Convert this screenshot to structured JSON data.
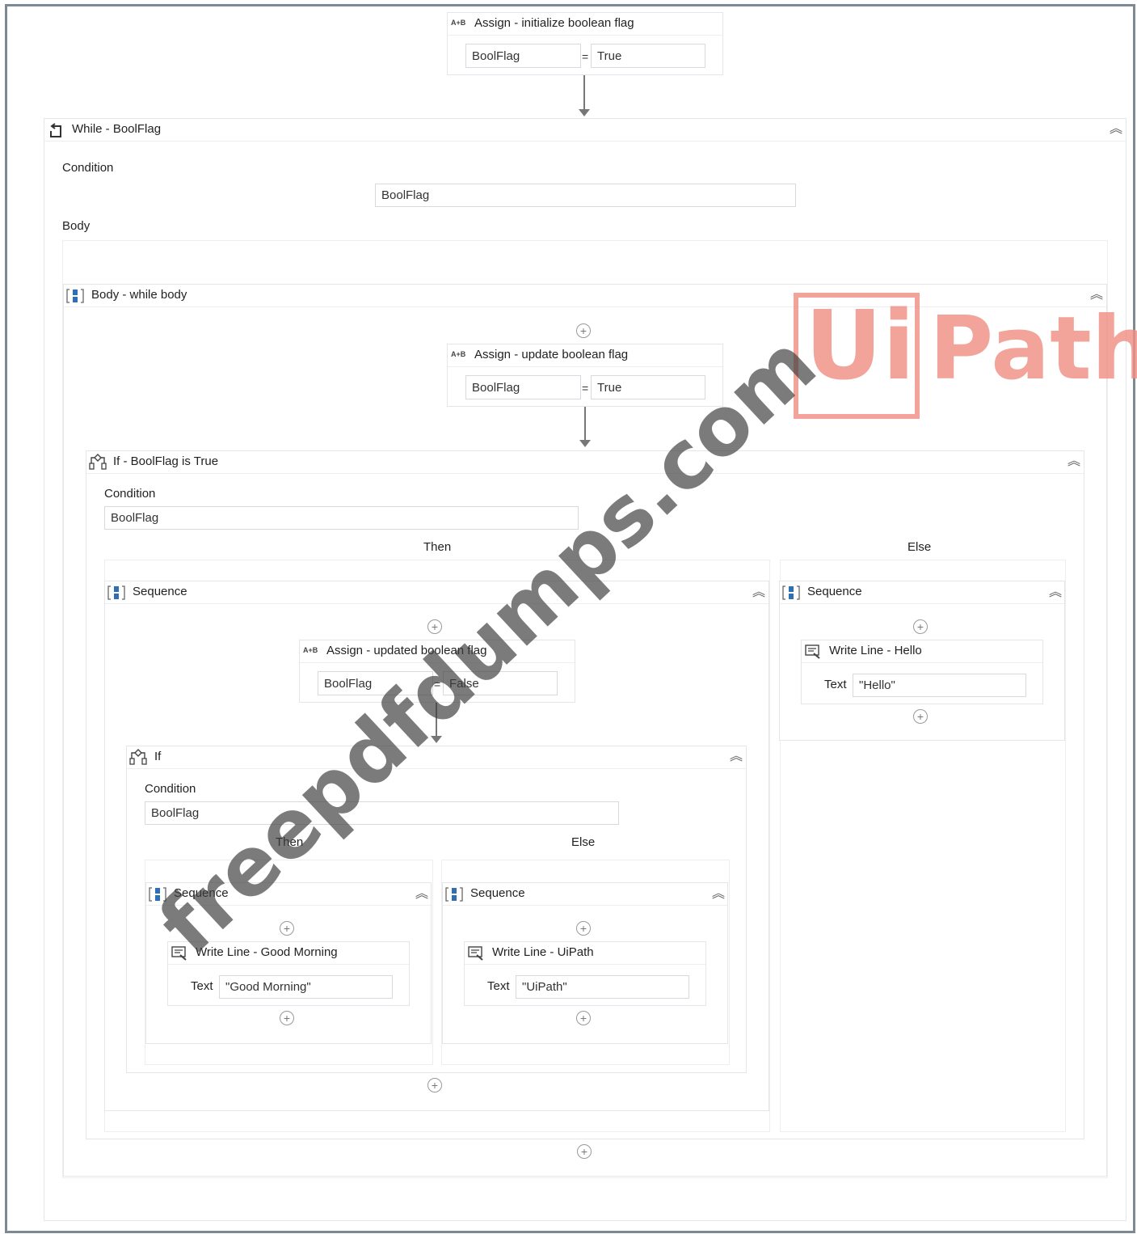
{
  "assign_init": {
    "title": "Assign - initialize boolean flag",
    "icon": "assign-icon",
    "left": "BoolFlag",
    "op": "=",
    "right": "True"
  },
  "while_block": {
    "title": "While - BoolFlag",
    "icon": "while-loop-icon",
    "condition_label": "Condition",
    "condition_value": "BoolFlag",
    "body_label": "Body"
  },
  "body_seq": {
    "title": "Body - while body",
    "icon": "sequence-icon"
  },
  "assign_update": {
    "title": "Assign - update boolean flag",
    "left": "BoolFlag",
    "op": "=",
    "right": "True"
  },
  "if_outer": {
    "title": "If - BoolFlag is True",
    "icon": "if-branch-icon",
    "condition_label": "Condition",
    "condition_value": "BoolFlag",
    "then_label": "Then",
    "else_label": "Else"
  },
  "then_seq": {
    "title": "Sequence"
  },
  "assign_updated": {
    "title": "Assign - updated boolean flag",
    "left": "BoolFlag",
    "op": "=",
    "right": "False"
  },
  "if_inner": {
    "title": "If",
    "condition_label": "Condition",
    "condition_value": "BoolFlag",
    "then_label": "Then",
    "else_label": "Else"
  },
  "inner_then_seq": {
    "title": "Sequence"
  },
  "write_good_morning": {
    "title": "Write Line - Good Morning",
    "text_label": "Text",
    "text_value": "\"Good Morning\""
  },
  "inner_else_seq": {
    "title": "Sequence"
  },
  "write_uipath": {
    "title": "Write Line - UiPath",
    "text_label": "Text",
    "text_value": "\"UiPath\""
  },
  "else_seq": {
    "title": "Sequence"
  },
  "write_hello": {
    "title": "Write Line - Hello",
    "text_label": "Text",
    "text_value": "\"Hello\""
  },
  "watermark": {
    "text": "freepdfdumps.com",
    "logo": "UiPath"
  },
  "colors": {
    "frame": "#7d8a95",
    "watermark": "#f08f85",
    "sequence_icon": "#2f6fb3"
  }
}
